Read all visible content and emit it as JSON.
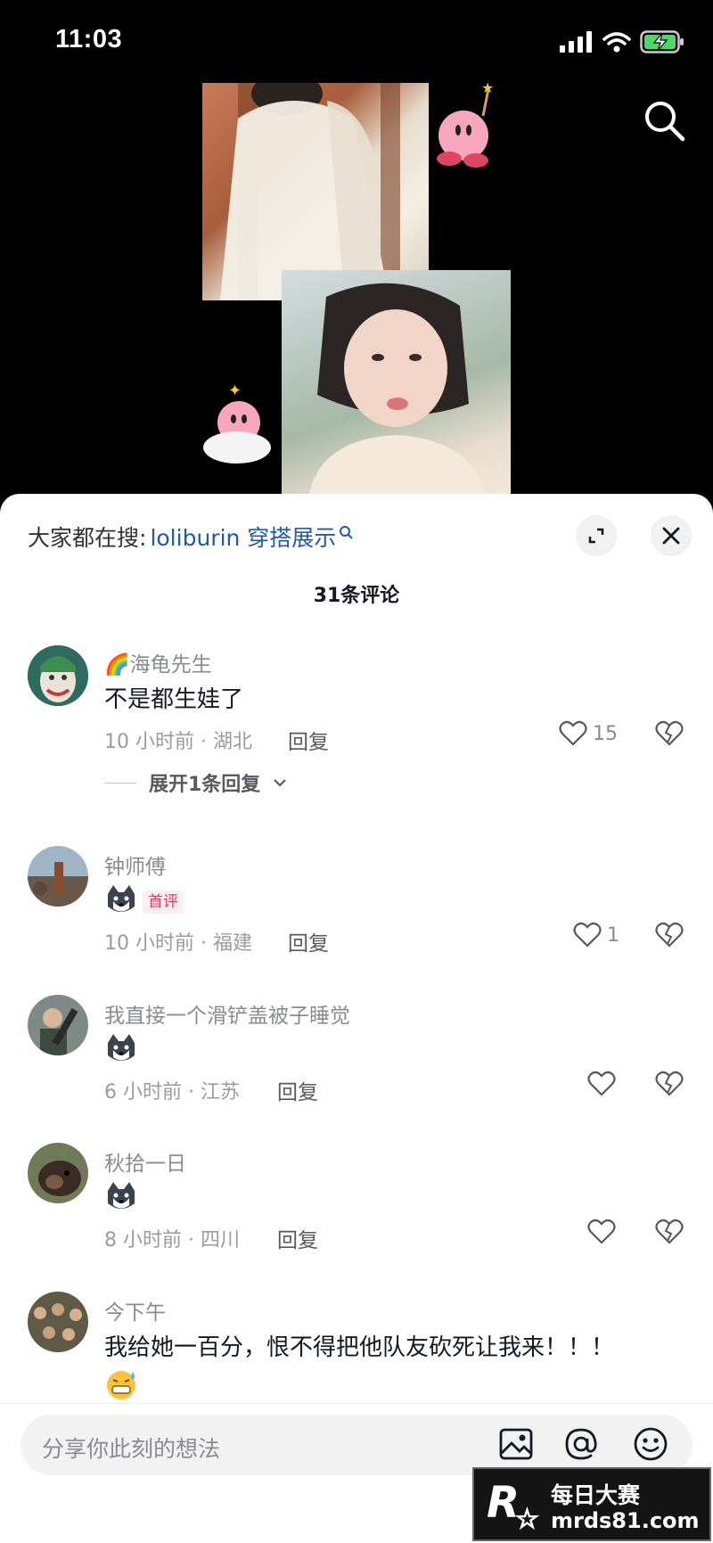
{
  "status_bar": {
    "time": "11:03"
  },
  "sheet": {
    "hot_search_prefix": "大家都在搜:",
    "hot_search_term": "loliburin 穿搭展示",
    "comment_count_title": "31条评论"
  },
  "comments": [
    {
      "nickname": "🌈海龟先生",
      "text": "不是都生娃了",
      "meta": "10 小时前 · 湖北",
      "reply_label": "回复",
      "likes": "15",
      "expand_label": "展开1条回复"
    },
    {
      "nickname": "钟师傅",
      "badge": "首评",
      "sticker": "husky-sticker",
      "meta": "10 小时前 · 福建",
      "reply_label": "回复",
      "likes": "1"
    },
    {
      "nickname": "我直接一个滑铲盖被子睡觉",
      "sticker": "husky-sticker",
      "meta": "6 小时前 · 江苏",
      "reply_label": "回复",
      "likes": ""
    },
    {
      "nickname": "秋拾一日",
      "sticker": "husky-sticker",
      "meta": "8 小时前 · 四川",
      "reply_label": "回复",
      "likes": ""
    },
    {
      "nickname": "今下午",
      "text": "我给她一百分，恨不得把他队友砍死让我来！！！",
      "sticker": "grimace-emoji"
    }
  ],
  "input": {
    "placeholder": "分享你此刻的想法"
  },
  "watermark": {
    "line1": "每日大赛",
    "line2": "mrds81.com",
    "logo": "R"
  },
  "colors": {
    "accent": "#fe2c55",
    "link": "#1f5aa5",
    "sheet_bg": "#ffffff"
  }
}
